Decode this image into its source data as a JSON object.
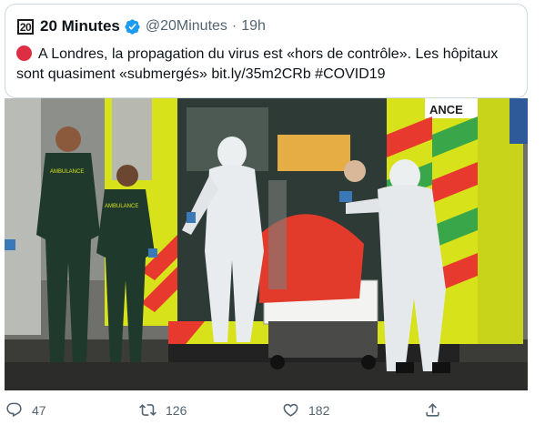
{
  "tweet": {
    "avatar_text": "20",
    "display_name": "20 Minutes",
    "handle": "@20Minutes",
    "separator": "·",
    "time": "19h",
    "text_before_link": "A Londres, la propagation du virus est «hors de contrôle». Les hôpitaux sont quasiment «submergés» ",
    "link": "bit.ly/35m2CRb",
    "hashtag": "#COVID19",
    "emoji_icon": "red-circle-icon"
  },
  "photo": {
    "ambulance_label": "ANCE",
    "uniform_badge": "AMBULANCE",
    "uniform_badge_2": "AMBULANCE"
  },
  "actions": {
    "reply_count": "47",
    "retweet_count": "126",
    "like_count": "182"
  },
  "colors": {
    "verified": "#1d9bf0",
    "ambulance_yellow": "#d7e21a",
    "ambulance_green": "#3aa64a",
    "blanket_red": "#e23a2b"
  }
}
